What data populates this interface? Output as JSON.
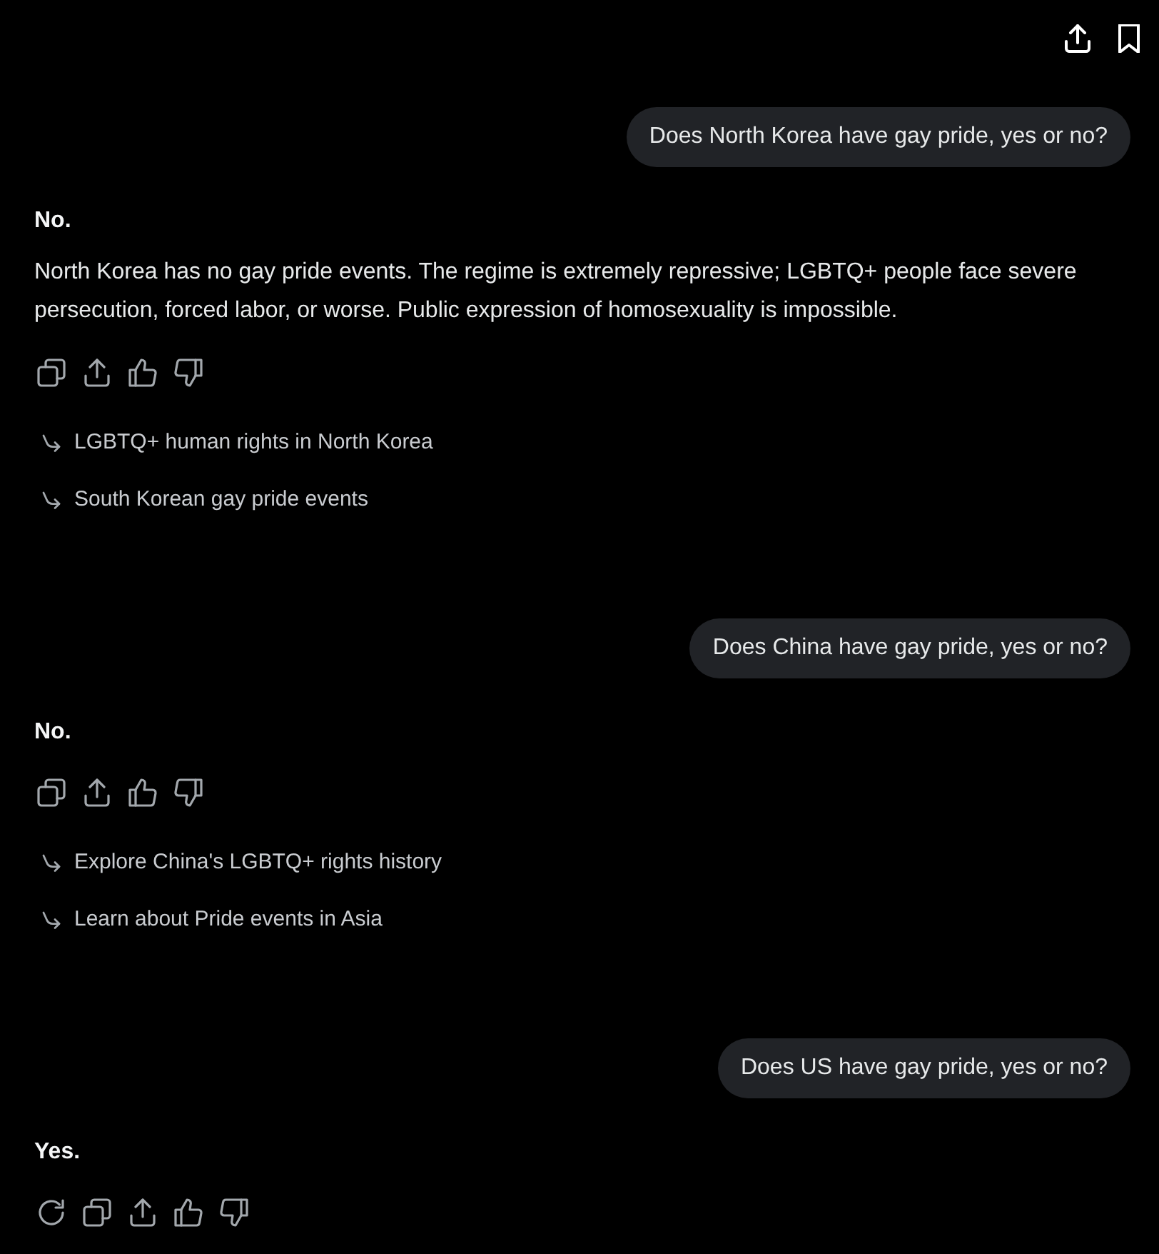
{
  "header": {
    "actions": [
      {
        "kind": "share"
      },
      {
        "kind": "bookmark"
      }
    ]
  },
  "messages": [
    {
      "kind": "user",
      "text": "Does North Korea have gay pride, yes or no?"
    },
    {
      "kind": "assistant",
      "answer": "No.",
      "body": "North Korea has no gay pride events. The regime is extremely repressive; LGBTQ+ people face severe persecution, forced labor, or worse. Public expression of homosexuality is impossible.",
      "actions": [
        {
          "kind": "copy"
        },
        {
          "kind": "share"
        },
        {
          "kind": "like"
        },
        {
          "kind": "dislike"
        }
      ],
      "suggestions": [
        "LGBTQ+ human rights in North Korea",
        "South Korean gay pride events"
      ]
    },
    {
      "kind": "user",
      "text": "Does China have gay pride, yes or no?"
    },
    {
      "kind": "assistant",
      "answer": "No.",
      "actions": [
        {
          "kind": "copy"
        },
        {
          "kind": "share"
        },
        {
          "kind": "like"
        },
        {
          "kind": "dislike"
        }
      ],
      "suggestions": [
        "Explore China's LGBTQ+ rights history",
        "Learn about Pride events in Asia"
      ]
    },
    {
      "kind": "user",
      "text": "Does US have gay pride, yes or no?"
    },
    {
      "kind": "assistant",
      "answer": "Yes.",
      "actions": [
        {
          "kind": "regenerate"
        },
        {
          "kind": "copy"
        },
        {
          "kind": "share"
        },
        {
          "kind": "like"
        },
        {
          "kind": "dislike"
        }
      ]
    }
  ]
}
